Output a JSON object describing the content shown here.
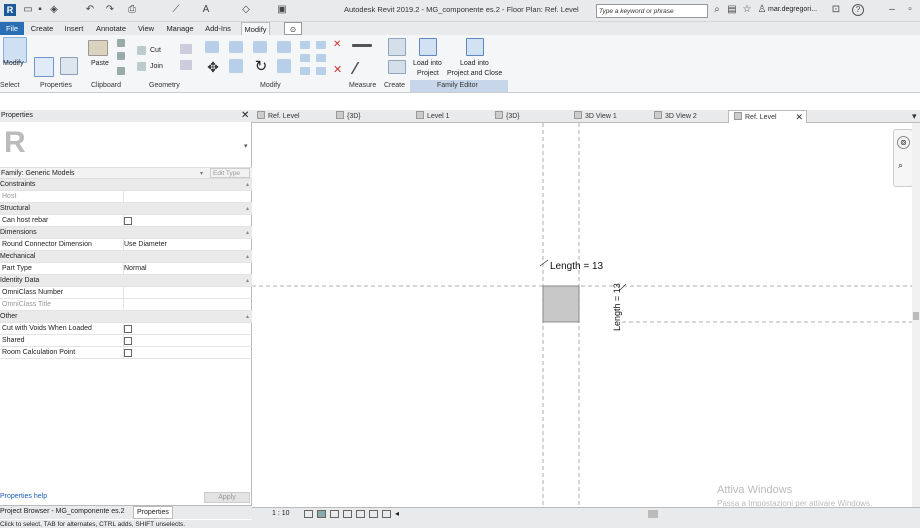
{
  "app": {
    "title": "Autodesk Revit 2019.2 - MG_componente es.2 - Floor Plan: Ref. Level",
    "search_placeholder": "Type a keyword or phrase",
    "user": "mar.degregori...",
    "help": "?"
  },
  "ribbon_tabs": [
    "File",
    "Create",
    "Insert",
    "Annotate",
    "View",
    "Manage",
    "Add-Ins",
    "Modify"
  ],
  "ribbon": {
    "modify": "Modify",
    "paste": "Paste",
    "cut": "Cut",
    "join": "Join",
    "load_into_project": [
      "Load into",
      "Project"
    ],
    "load_into_project_close": [
      "Load into",
      "Project and Close"
    ],
    "panels": [
      "Select",
      "Properties",
      "Clipboard",
      "Geometry",
      "Modify",
      "Measure",
      "Create",
      "Family Editor"
    ]
  },
  "properties": {
    "header": "Properties",
    "type_selector": "Family: Generic Models",
    "edit_type": "Edit Type",
    "rows": [
      {
        "k": "Constraints",
        "group": true
      },
      {
        "k": "Host",
        "v": "",
        "muted": true
      },
      {
        "k": "Structural",
        "group": true
      },
      {
        "k": "Can host rebar",
        "v": "",
        "checkbox": true
      },
      {
        "k": "Dimensions",
        "group": true
      },
      {
        "k": "Round Connector Dimension",
        "v": "Use Diameter"
      },
      {
        "k": "Mechanical",
        "group": true
      },
      {
        "k": "Part Type",
        "v": "Normal"
      },
      {
        "k": "Identity Data",
        "group": true
      },
      {
        "k": "OmniClass Number",
        "v": ""
      },
      {
        "k": "OmniClass Title",
        "v": "",
        "muted": true
      },
      {
        "k": "Other",
        "group": true
      },
      {
        "k": "Cut with Voids When Loaded",
        "v": "",
        "checkbox": true
      },
      {
        "k": "Shared",
        "v": "",
        "checkbox": true
      },
      {
        "k": "Room Calculation Point",
        "v": "",
        "checkbox": true
      }
    ],
    "help_link": "Properties help",
    "apply": "Apply"
  },
  "bottom_tabs": [
    "Project Browser - MG_componente es.2",
    "Properties"
  ],
  "view_tabs": [
    "Ref. Level",
    "{3D}",
    "Level 1",
    "{3D}",
    "3D View 1",
    "3D View 2",
    "Ref. Level"
  ],
  "canvas": {
    "dim_horizontal": "Length = 13",
    "dim_vertical": "Length = 13"
  },
  "status": {
    "scale": "1 : 10",
    "hint": "Click to select, TAB for alternates, CTRL adds, SHIFT unselects."
  },
  "watermark": {
    "line1": "Attiva Windows",
    "line2": "Passa a Impostazioni per attivare Windows."
  }
}
